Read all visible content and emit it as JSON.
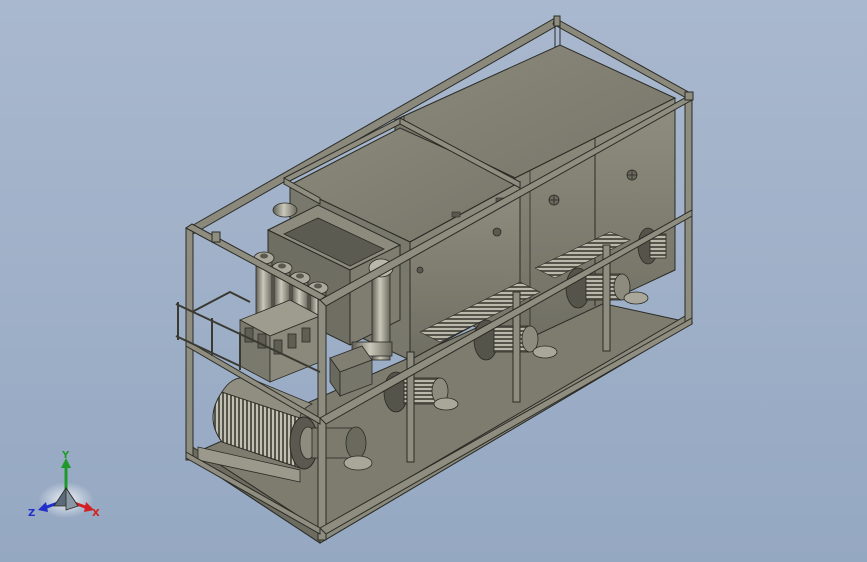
{
  "viewport": {
    "background_top": "#a9b8ce",
    "background_bottom": "#95a8c2",
    "model_color": "#8c8b7c",
    "model_dark": "#5e5d52",
    "model_light": "#b2b1a2",
    "edge_color": "#2b2b26"
  },
  "triad": {
    "x_label": "X",
    "y_label": "Y",
    "z_label": "Z",
    "x_color": "#d42020",
    "y_color": "#1f9a2a",
    "z_color": "#2030c8"
  }
}
